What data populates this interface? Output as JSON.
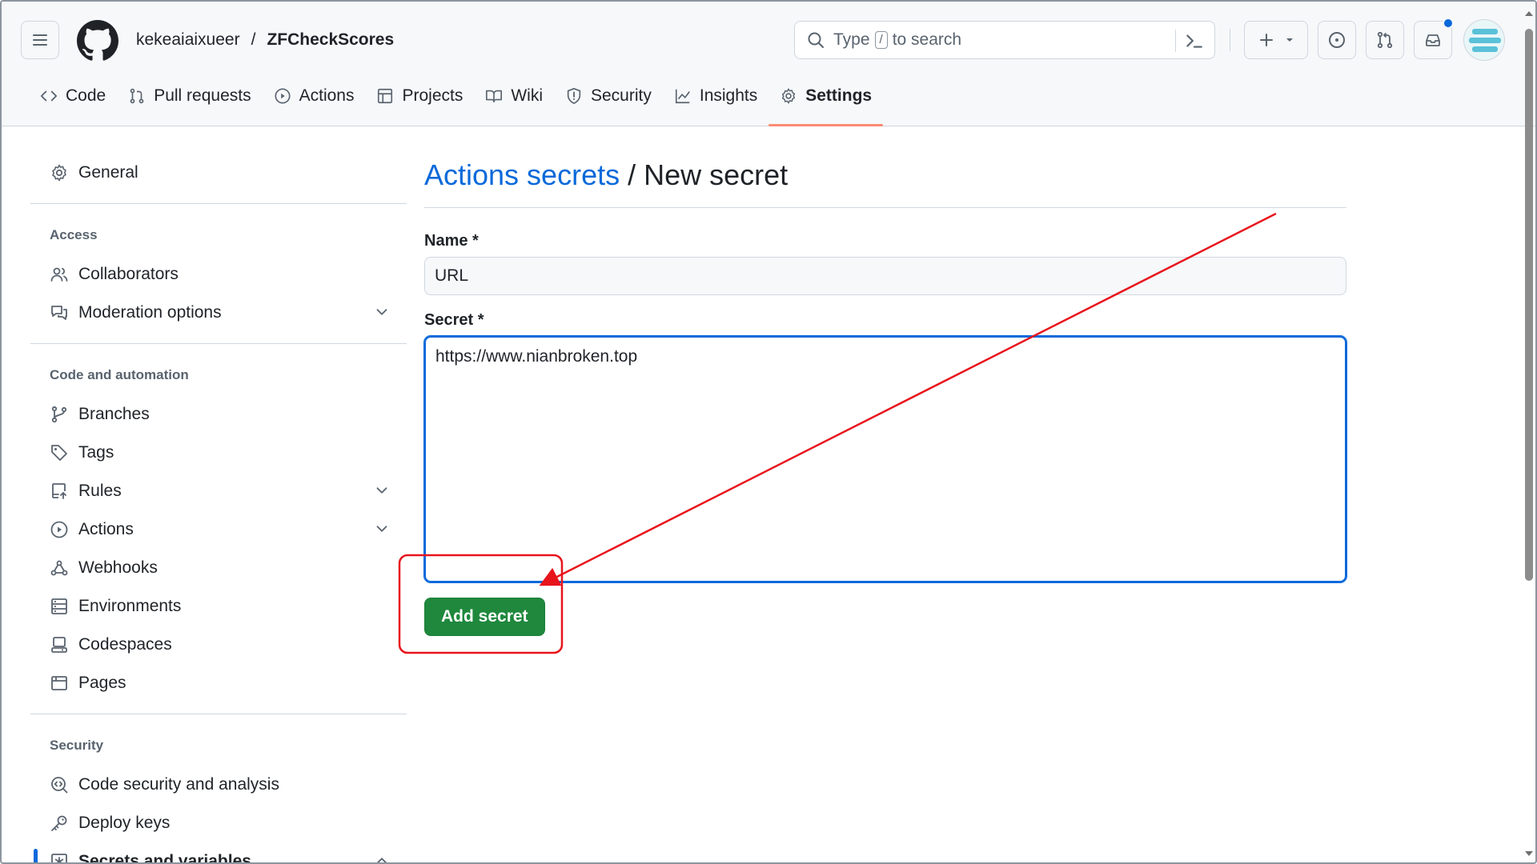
{
  "header": {
    "owner": "kekeaiaixueer",
    "separator": "/",
    "repo": "ZFCheckScores",
    "search": {
      "prefix": "Type",
      "key": "/",
      "suffix": "to search"
    }
  },
  "tabs": [
    {
      "label": "Code",
      "icon": "code-icon"
    },
    {
      "label": "Pull requests",
      "icon": "pull-request-icon"
    },
    {
      "label": "Actions",
      "icon": "play-icon"
    },
    {
      "label": "Projects",
      "icon": "table-icon"
    },
    {
      "label": "Wiki",
      "icon": "book-icon"
    },
    {
      "label": "Security",
      "icon": "shield-icon"
    },
    {
      "label": "Insights",
      "icon": "graph-icon"
    },
    {
      "label": "Settings",
      "icon": "gear-icon",
      "active": true
    }
  ],
  "sidebar": {
    "general": "General",
    "access_heading": "Access",
    "collaborators": "Collaborators",
    "moderation": "Moderation options",
    "code_heading": "Code and automation",
    "branches": "Branches",
    "tags": "Tags",
    "rules": "Rules",
    "actions": "Actions",
    "webhooks": "Webhooks",
    "environments": "Environments",
    "codespaces": "Codespaces",
    "pages": "Pages",
    "security_heading": "Security",
    "code_security": "Code security and analysis",
    "deploy_keys": "Deploy keys",
    "secrets": "Secrets and variables"
  },
  "main": {
    "crumb": "Actions secrets",
    "crumb_sep": " / ",
    "title": "New secret",
    "name_label": "Name *",
    "name_value": "URL",
    "secret_label": "Secret *",
    "secret_value": "https://www.nianbroken.top",
    "submit_label": "Add secret"
  },
  "colors": {
    "accent": "#0969da",
    "primary_button": "#1f883d",
    "active_tab_underline": "#fd8c73",
    "annotation": "#e8141c"
  }
}
